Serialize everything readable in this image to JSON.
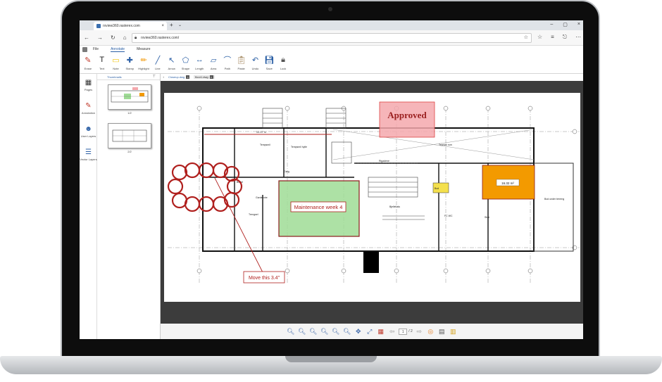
{
  "browser": {
    "tab_title": "rxview360.rasterex.com",
    "url": "rxview360.rasterex.com/"
  },
  "menu": {
    "file": "File",
    "annotate": "Annotate",
    "measure": "Measure"
  },
  "ribbon": [
    {
      "label": "Erase",
      "icon": "eraser-icon"
    },
    {
      "label": "Text",
      "icon": "text-icon"
    },
    {
      "label": "Note",
      "icon": "note-icon"
    },
    {
      "label": "Stamp",
      "icon": "stamp-icon"
    },
    {
      "label": "Highlight",
      "icon": "highlight-icon"
    },
    {
      "label": "Line",
      "icon": "line-icon"
    },
    {
      "label": "Arrow",
      "icon": "arrow-icon"
    },
    {
      "label": "Shape",
      "icon": "shape-icon"
    },
    {
      "label": "Length",
      "icon": "length-icon"
    },
    {
      "label": "Area",
      "icon": "area-icon"
    },
    {
      "label": "Path",
      "icon": "path-icon"
    },
    {
      "label": "Paste",
      "icon": "paste-icon"
    },
    {
      "label": "Undo",
      "icon": "undo-icon"
    },
    {
      "label": "Save",
      "icon": "save-icon"
    },
    {
      "label": "Lock",
      "icon": "lock-icon"
    }
  ],
  "sidebar": [
    {
      "label": "Pages",
      "icon": "pages-grid-icon"
    },
    {
      "label": "Annotation",
      "icon": "pencil-icon"
    },
    {
      "label": "User Layers",
      "icon": "user-layers-icon"
    },
    {
      "label": "Vector Layers",
      "icon": "vector-layers-icon"
    }
  ],
  "thumbnails": {
    "header": "Thumbnails",
    "pages": [
      "1/2",
      "2/2"
    ]
  },
  "doc_tabs": [
    "Closeup.dwg",
    "floor1.dwg"
  ],
  "drawing": {
    "stamp": "Approved",
    "callout": "Maintenance week 4",
    "area": "16.32 m²",
    "length": "33.47 m",
    "note": "Move this 3.4\"",
    "room_labels": [
      "Tempsmil",
      "Tempsmil hylle",
      "Garg",
      "Bodel",
      "Garderobe",
      "Rigadene",
      "Trengsel",
      "Stue",
      "Tekniak rom",
      "Bod under terreng",
      "Bod",
      "FC WC",
      "Bjellehals"
    ],
    "colors": {
      "stamp": "#f4a8ad",
      "callout": "#9fdc95",
      "area": "#f39a00",
      "note_line": "#b0201e"
    }
  },
  "bottom": {
    "page_current": "1",
    "page_total": "/ 2"
  }
}
